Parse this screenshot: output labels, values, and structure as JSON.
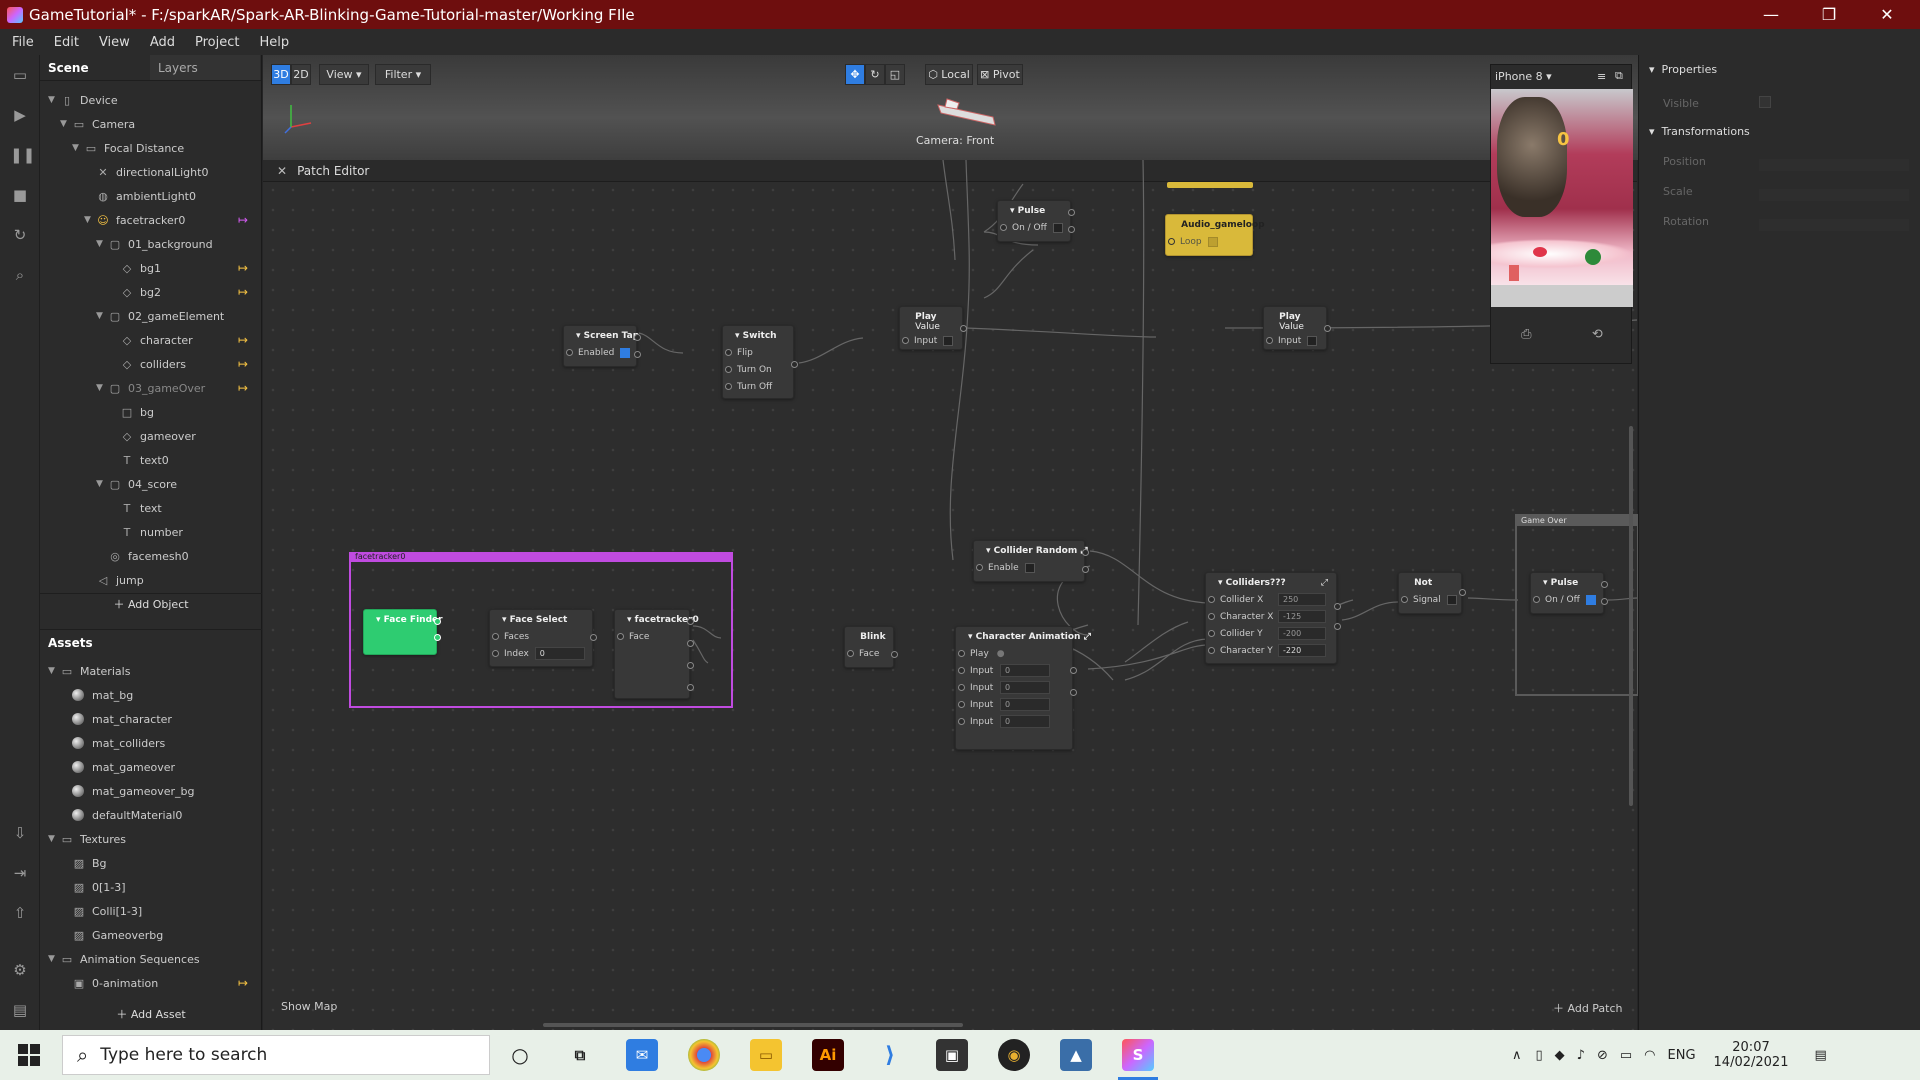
{
  "window": {
    "title": "GameTutorial* - F:/sparkAR/Spark-AR-Blinking-Game-Tutorial-master/Working FIle"
  },
  "menu": [
    "File",
    "Edit",
    "View",
    "Add",
    "Project",
    "Help"
  ],
  "scene_tabs": {
    "scene": "Scene",
    "layers": "Layers"
  },
  "tree": [
    {
      "label": "Device",
      "icon": "device-icon",
      "depth": 0,
      "caret": "▼"
    },
    {
      "label": "Camera",
      "icon": "camera-icon",
      "depth": 1,
      "caret": "▼"
    },
    {
      "label": "Focal Distance",
      "icon": "focal-icon",
      "depth": 2,
      "caret": "▼"
    },
    {
      "label": "directionalLight0",
      "icon": "directional-light-icon",
      "depth": 3,
      "caret": ""
    },
    {
      "label": "ambientLight0",
      "icon": "ambient-light-icon",
      "depth": 3,
      "caret": ""
    },
    {
      "label": "facetracker0",
      "icon": "facetracker-icon",
      "depth": 3,
      "caret": "▼",
      "tag": "pink"
    },
    {
      "label": "01_background",
      "icon": "canvas-icon",
      "depth": 4,
      "caret": "▼"
    },
    {
      "label": "bg1",
      "icon": "plane-icon",
      "depth": 5,
      "caret": "",
      "tag": "gold"
    },
    {
      "label": "bg2",
      "icon": "plane-icon",
      "depth": 5,
      "caret": "",
      "tag": "gold"
    },
    {
      "label": "02_gameElement",
      "icon": "canvas-icon",
      "depth": 4,
      "caret": "▼"
    },
    {
      "label": "character",
      "icon": "plane-icon",
      "depth": 5,
      "caret": "",
      "tag": "gold"
    },
    {
      "label": "colliders",
      "icon": "plane-icon",
      "depth": 5,
      "caret": "",
      "tag": "gold"
    },
    {
      "label": "03_gameOver",
      "icon": "canvas-icon",
      "depth": 4,
      "caret": "▼",
      "tag": "gold",
      "dim": true
    },
    {
      "label": "bg",
      "icon": "rectangle-icon",
      "depth": 5,
      "caret": ""
    },
    {
      "label": "gameover",
      "icon": "plane-icon",
      "depth": 5,
      "caret": ""
    },
    {
      "label": "text0",
      "icon": "text-icon",
      "depth": 5,
      "caret": ""
    },
    {
      "label": "04_score",
      "icon": "canvas-icon",
      "depth": 4,
      "caret": "▼"
    },
    {
      "label": "text",
      "icon": "text-icon",
      "depth": 5,
      "caret": ""
    },
    {
      "label": "number",
      "icon": "text-icon",
      "depth": 5,
      "caret": ""
    },
    {
      "label": "facemesh0",
      "icon": "facemesh-icon",
      "depth": 4,
      "caret": ""
    },
    {
      "label": "jump",
      "icon": "speaker-icon",
      "depth": 3,
      "caret": ""
    }
  ],
  "add_object": "Add Object",
  "assets_title": "Assets",
  "assets": [
    {
      "label": "Materials",
      "kind": "folder",
      "depth": 0
    },
    {
      "label": "mat_bg",
      "kind": "material",
      "depth": 1
    },
    {
      "label": "mat_character",
      "kind": "material",
      "depth": 1
    },
    {
      "label": "mat_colliders",
      "kind": "material",
      "depth": 1
    },
    {
      "label": "mat_gameover",
      "kind": "material",
      "depth": 1
    },
    {
      "label": "mat_gameover_bg",
      "kind": "material",
      "depth": 1
    },
    {
      "label": "defaultMaterial0",
      "kind": "material",
      "depth": 1
    },
    {
      "label": "Textures",
      "kind": "folder",
      "depth": 0
    },
    {
      "label": "Bg",
      "kind": "texture",
      "depth": 1
    },
    {
      "label": "0[1-3]",
      "kind": "texture",
      "depth": 1
    },
    {
      "label": "Colli[1-3]",
      "kind": "texture",
      "depth": 1
    },
    {
      "label": "Gameoverbg",
      "kind": "texture",
      "depth": 1
    },
    {
      "label": "Animation Sequences",
      "kind": "folder",
      "depth": 0
    },
    {
      "label": "0-animation",
      "kind": "animation",
      "depth": 1,
      "tag": "gold"
    }
  ],
  "add_asset": "Add Asset",
  "viewport": {
    "mode3d": "3D",
    "mode2d": "2D",
    "view": "View",
    "filter": "Filter",
    "local": "Local",
    "pivot": "Pivot",
    "camera_label": "Camera: Front"
  },
  "preview": {
    "device": "iPhone 8",
    "score": "0"
  },
  "patch_editor": {
    "title": "Patch Editor",
    "show_map": "Show Map",
    "add_patch": "Add Patch"
  },
  "nodes": {
    "pulse1": {
      "title": "Pulse",
      "row": "On / Off"
    },
    "audio": {
      "title": "Audio_gameloop",
      "row": "Loop"
    },
    "screentap": {
      "title": "Screen Tap",
      "row": "Enabled"
    },
    "switch": {
      "title": "Switch",
      "rows": [
        "Flip",
        "Turn On",
        "Turn Off"
      ]
    },
    "play1": {
      "title": "Play",
      "sub": "Value",
      "row": "Input"
    },
    "play2": {
      "title": "Play",
      "sub": "Value",
      "row": "Input"
    },
    "collider_random": {
      "title": "Collider Random",
      "row": "Enable"
    },
    "colliders": {
      "title": "Colliders???",
      "rows": [
        "Collider X",
        "Character X",
        "Collider Y",
        "Character Y"
      ],
      "values": [
        "250",
        "-125",
        "-200",
        "-220"
      ]
    },
    "not": {
      "title": "Not",
      "row": "Signal"
    },
    "pulse2": {
      "title": "Pulse",
      "row": "On / Off"
    },
    "face_finder": {
      "title": "Face Finder"
    },
    "face_select": {
      "title": "Face Select",
      "rows": [
        "Faces",
        "Index"
      ],
      "index_value": "0"
    },
    "facetracker": {
      "title": "facetracker0",
      "row": "Face"
    },
    "blink": {
      "title": "Blink",
      "row": "Face"
    },
    "char_anim": {
      "title": "Character Animation",
      "rows": [
        "Play",
        "Input",
        "Input",
        "Input",
        "Input"
      ],
      "values": [
        "0",
        "0",
        "0",
        "0"
      ]
    }
  },
  "groups": {
    "facetracker_group": "facetracker0",
    "game_over_group": "Game Over"
  },
  "properties": {
    "title": "Properties",
    "visible": "Visible",
    "transformations": "Transformations",
    "fields": [
      "Position",
      "Scale",
      "Rotation"
    ]
  },
  "taskbar": {
    "search_placeholder": "Type here to search",
    "lang": "ENG",
    "time": "20:07",
    "date": "14/02/2021"
  },
  "colors": {
    "titlebar": "#6e0e0e",
    "accent": "#2f7de1",
    "group": "#c04be0",
    "face_finder": "#2ecc71",
    "audio": "#e0c23c"
  }
}
